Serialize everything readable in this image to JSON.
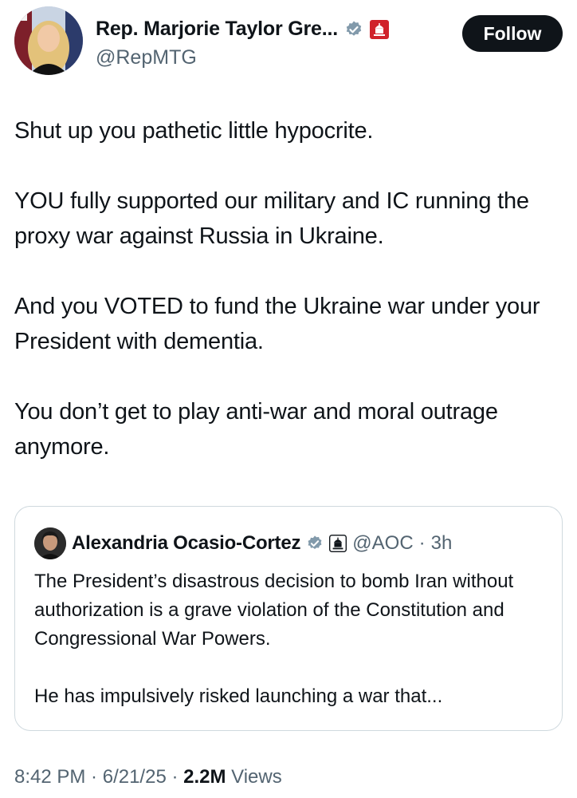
{
  "author": {
    "name": "Rep. Marjorie Taylor Gre...",
    "handle": "@RepMTG",
    "verified_icon": "verified-badge-gray",
    "affiliation_icon": "capitol-red-badge"
  },
  "follow_label": "Follow",
  "body": [
    "Shut up you pathetic little hypocrite.",
    "YOU fully supported our military and IC running the proxy war against Russia in Ukraine.",
    "And you VOTED to fund the Ukraine war under your President with dementia.",
    "You don’t get to play anti-war and moral outrage anymore."
  ],
  "quote": {
    "name": "Alexandria Ocasio-Cortez",
    "handle": "@AOC",
    "separator": "·",
    "time": "3h",
    "verified_icon": "verified-badge-gray",
    "affiliation_icon": "capitol-black-badge",
    "text": [
      "The President’s disastrous decision to bomb Iran without authorization is a grave violation of the Constitution and Congressional War Powers.",
      "He has impulsively risked launching a war that..."
    ]
  },
  "meta": {
    "time": "8:42 PM",
    "sep1": " · ",
    "date": "6/21/25",
    "sep2": " · ",
    "views_count": "2.2M",
    "views_label": " Views"
  },
  "colors": {
    "text": "#0f1419",
    "secondary": "#536471",
    "border": "#cfd9de",
    "verified": "#829aab",
    "affiliation_red": "#d0212a"
  }
}
